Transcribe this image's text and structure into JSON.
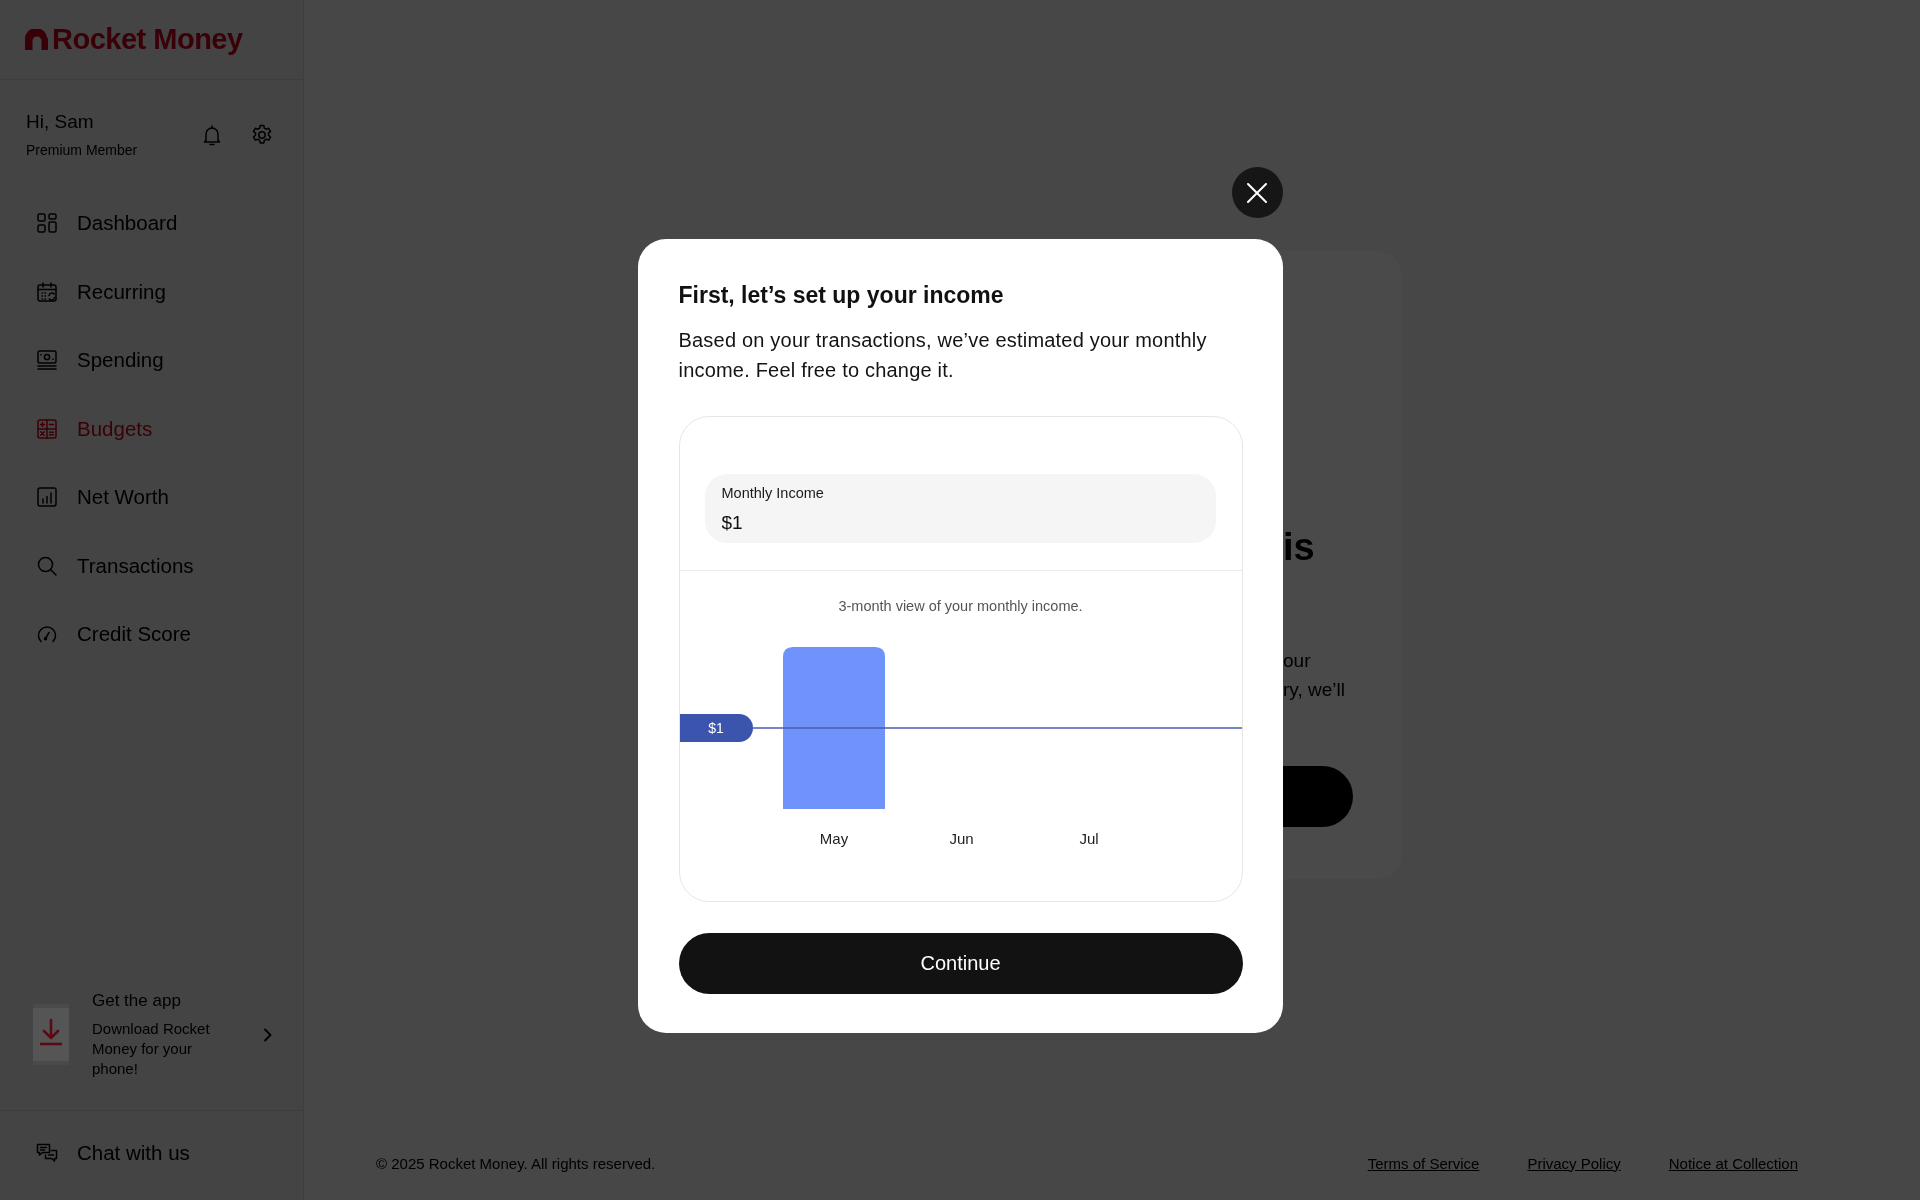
{
  "sidebar": {
    "logo": {
      "text": "Rocket Money"
    },
    "greeting": "Hi, Sam",
    "membership": "Premium Member",
    "nav": [
      {
        "label": "Dashboard",
        "selected": false
      },
      {
        "label": "Recurring",
        "selected": false
      },
      {
        "label": "Spending",
        "selected": false
      },
      {
        "label": "Budgets",
        "selected": true
      },
      {
        "label": "Net Worth",
        "selected": false
      },
      {
        "label": "Transactions",
        "selected": false
      },
      {
        "label": "Credit Score",
        "selected": false
      }
    ],
    "promo": {
      "title": "Get the app",
      "text": "Download Rocket Money for your phone!"
    },
    "chat": {
      "label": "Chat with us"
    }
  },
  "background_card": {
    "heading": "is",
    "text_lines": [
      "our",
      "ry, we’ll"
    ]
  },
  "modal": {
    "title": "First, let’s set up your income",
    "description": "Based on your transactions, we’ve estimated your monthly income. Feel free to change it.",
    "income_field": {
      "label": "Monthly Income",
      "value": "$1"
    },
    "income_chart": {
      "caption": "3-month view of your monthly income.",
      "line_label": "$1",
      "months": [
        "May",
        "Jun",
        "Jul"
      ]
    },
    "continue_button": "Continue"
  },
  "footer": {
    "copyright": "© 2025 Rocket Money. All rights reserved.",
    "links": [
      "Terms of Service",
      "Privacy Policy",
      "Notice at Collection"
    ]
  }
}
